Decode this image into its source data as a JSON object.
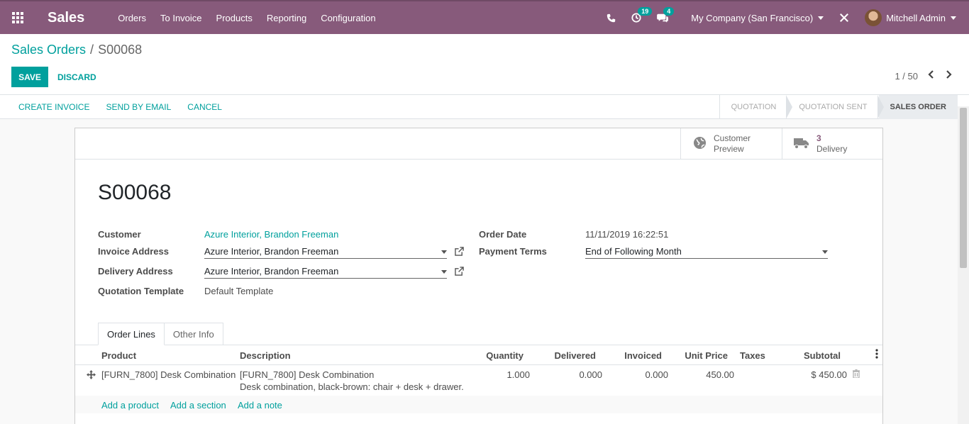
{
  "navbar": {
    "app_name": "Sales",
    "menu": [
      "Orders",
      "To Invoice",
      "Products",
      "Reporting",
      "Configuration"
    ],
    "activity_count": "19",
    "messages_count": "4",
    "company": "My Company (San Francisco)",
    "user": "Mitchell Admin",
    "accent_color": "#875a7b"
  },
  "breadcrumb": {
    "parent": "Sales Orders",
    "separator": "/",
    "current": "S00068"
  },
  "buttons": {
    "save": "SAVE",
    "discard": "DISCARD"
  },
  "pager": {
    "value": "1 / 50"
  },
  "actions": [
    "CREATE INVOICE",
    "SEND BY EMAIL",
    "CANCEL"
  ],
  "stages": [
    "QUOTATION",
    "QUOTATION SENT",
    "SALES ORDER"
  ],
  "smart_buttons": {
    "preview_line1": "Customer",
    "preview_line2": "Preview",
    "delivery_count": "3",
    "delivery_label": "Delivery"
  },
  "order": {
    "name": "S00068",
    "labels": {
      "customer": "Customer",
      "invoice_address": "Invoice Address",
      "delivery_address": "Delivery Address",
      "quotation_template": "Quotation Template",
      "order_date": "Order Date",
      "payment_terms": "Payment Terms"
    },
    "customer": "Azure Interior, Brandon Freeman",
    "invoice_address": "Azure Interior, Brandon Freeman",
    "delivery_address": "Azure Interior, Brandon Freeman",
    "quotation_template": "Default Template",
    "order_date": "11/11/2019 16:22:51",
    "payment_terms": "End of Following Month"
  },
  "tabs": [
    "Order Lines",
    "Other Info"
  ],
  "table": {
    "headers": [
      "Product",
      "Description",
      "Quantity",
      "Delivered",
      "Invoiced",
      "Unit Price",
      "Taxes",
      "Subtotal"
    ],
    "rows": [
      {
        "product": "[FURN_7800] Desk Combination",
        "description_line1": "[FURN_7800] Desk Combination",
        "description_line2": "Desk combination, black-brown: chair + desk + drawer.",
        "quantity": "1.000",
        "delivered": "0.000",
        "invoiced": "0.000",
        "unit_price": "450.00",
        "taxes": "",
        "subtotal": "$ 450.00"
      }
    ],
    "add_links": [
      "Add a product",
      "Add a section",
      "Add a note"
    ]
  }
}
